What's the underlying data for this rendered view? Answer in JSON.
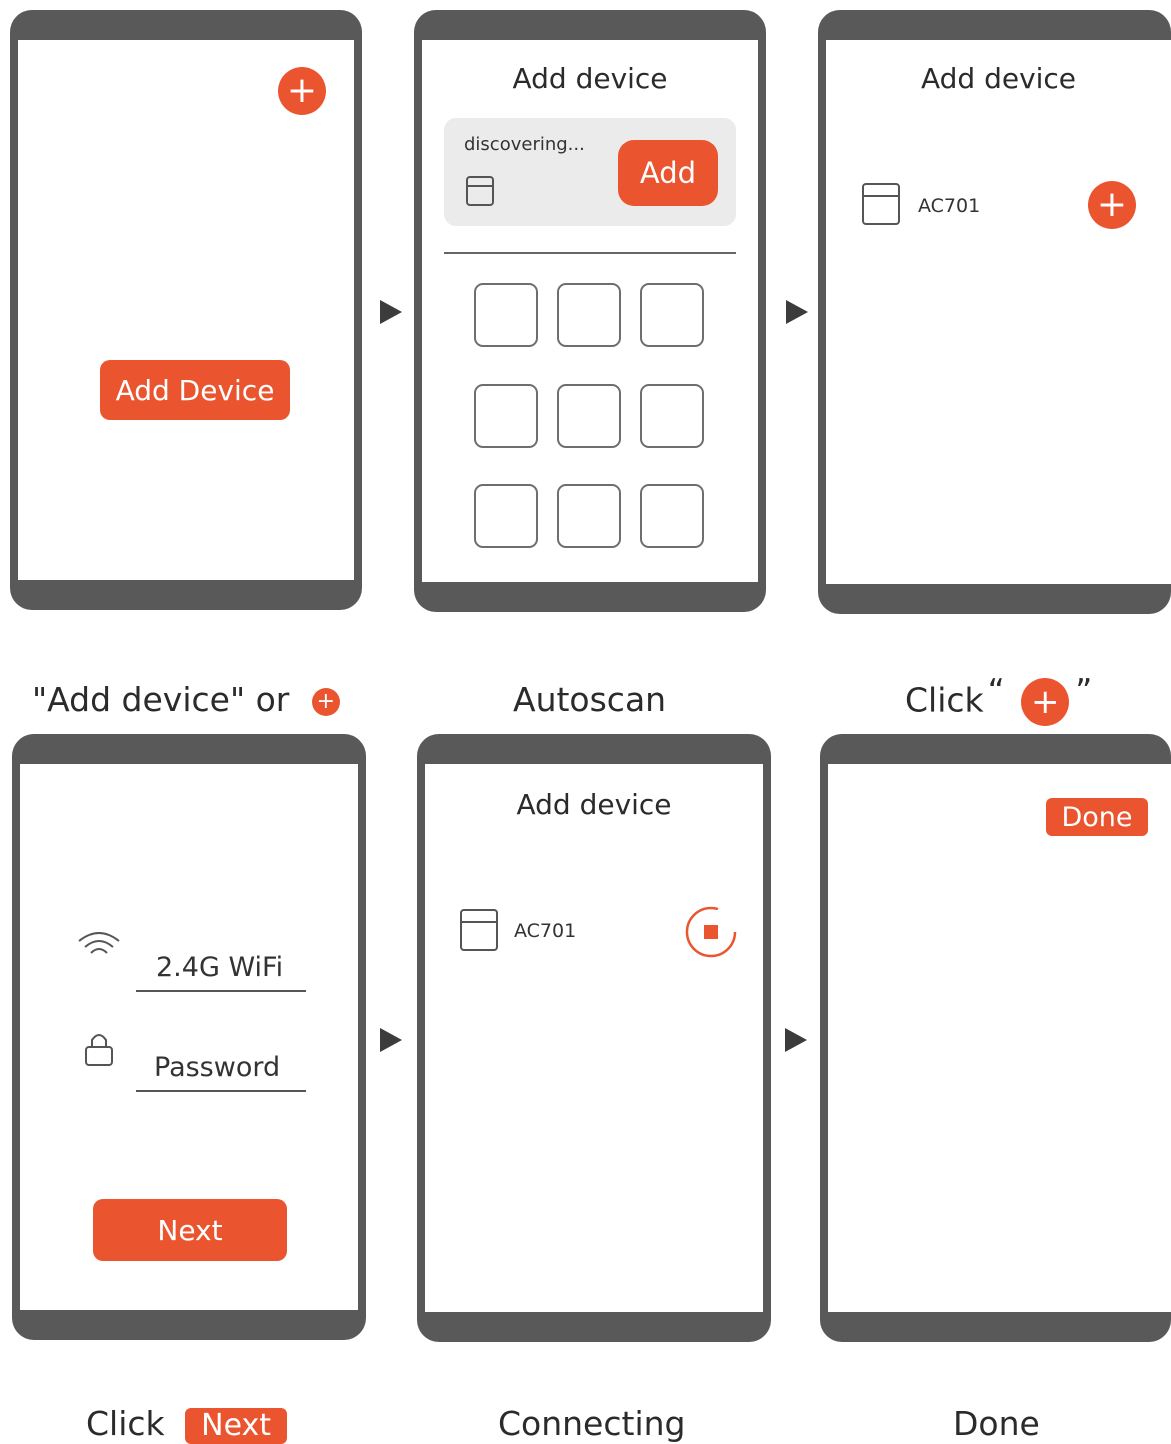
{
  "colors": {
    "accent": "#ea5530",
    "phone_frame": "#595959"
  },
  "step1": {
    "add_device_button": "Add Device",
    "plus_icon": "plus-icon"
  },
  "step2": {
    "title": "Add device",
    "status": "discovering...",
    "add_button": "Add",
    "tile_count": 9
  },
  "step3": {
    "title": "Add device",
    "device_name": "AC701"
  },
  "step4": {
    "wifi_label": "2.4G WiFi",
    "password_label": "Password",
    "next_button": "Next"
  },
  "step5": {
    "title": "Add device",
    "device_name": "AC701"
  },
  "step6": {
    "done_button": "Done"
  },
  "captions": {
    "c1": "\"Add device\" or",
    "c2": "Autoscan",
    "c3_prefix": "Click",
    "c3_open": "“",
    "c3_close": "”",
    "c4_prefix": "Click",
    "c4_badge": "Next",
    "c5": "Connecting",
    "c6": "Done"
  }
}
